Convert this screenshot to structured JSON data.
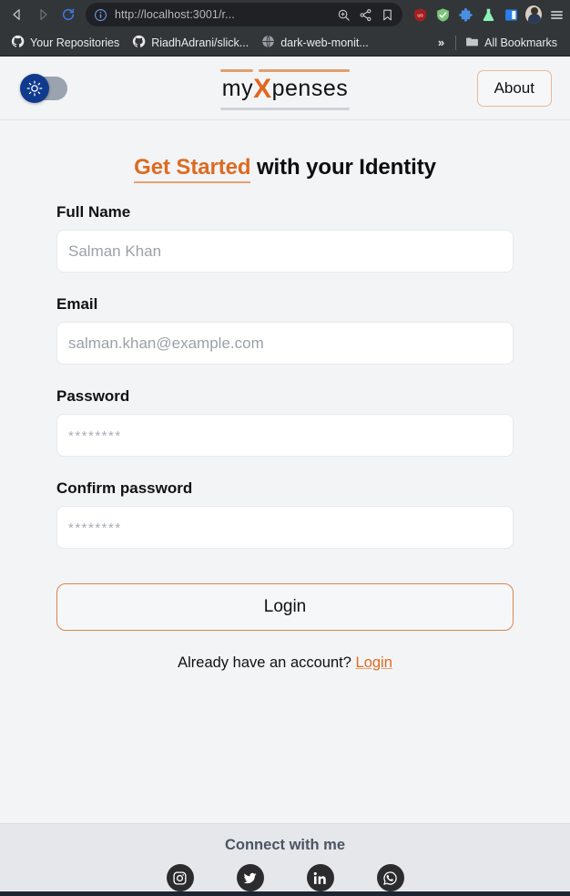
{
  "browser": {
    "nav": {
      "back_icon": "back-arrow-icon",
      "forward_icon": "forward-arrow-icon",
      "reload_icon": "reload-icon"
    },
    "urlbar": {
      "site_info_icon": "site-info-icon",
      "url": "http://localhost:3001/r...",
      "zoom_icon": "zoom-icon",
      "share_icon": "share-icon",
      "bookmark_icon": "bookmark-star-icon"
    },
    "extensions": [
      {
        "name": "ublock-origin-icon",
        "color": "#a81e1e",
        "label": "uo"
      },
      {
        "name": "shield-check-icon",
        "color": "#7bc67b"
      },
      {
        "name": "puzzle-extensions-icon",
        "color": "#4a90e2"
      },
      {
        "name": "flask-beaker-icon",
        "color": "#8ef2b8"
      },
      {
        "name": "sidebar-panel-icon",
        "color": "#2b7de9"
      },
      {
        "name": "profile-avatar-icon"
      },
      {
        "name": "browser-menu-icon"
      }
    ],
    "bookmarks": [
      {
        "label": "Your Repositories",
        "icon": "github-icon"
      },
      {
        "label": "RiadhAdrani/slick...",
        "icon": "github-icon"
      },
      {
        "label": "dark-web-monit...",
        "icon": "globe-icon"
      }
    ],
    "overflow_label": "»",
    "all_bookmarks": {
      "label": "All Bookmarks",
      "icon": "folder-icon"
    }
  },
  "header": {
    "theme_toggle": {
      "name": "theme-toggle",
      "state": "light",
      "icon": "sun-icon"
    },
    "logo": {
      "prefix": "my",
      "accent": "X",
      "suffix": "penses",
      "accent_color": "#e2661f",
      "rule_color": "#e0a070"
    },
    "about_label": "About"
  },
  "main": {
    "headline": {
      "accent": "Get Started",
      "rest": " with your Identity"
    },
    "fields": [
      {
        "label": "Full Name",
        "placeholder": "Salman Khan",
        "value": "",
        "type": "text",
        "name": "full-name"
      },
      {
        "label": "Email",
        "placeholder": "salman.khan@example.com",
        "value": "",
        "type": "email",
        "name": "email"
      },
      {
        "label": "Password",
        "placeholder": "********",
        "value": "",
        "type": "password",
        "name": "password"
      },
      {
        "label": "Confirm password",
        "placeholder": "********",
        "value": "",
        "type": "password",
        "name": "confirm-password"
      }
    ],
    "submit_label": "Login",
    "already_text": "Already have an account?",
    "already_link": "Login"
  },
  "footer": {
    "title": "Connect with me",
    "socials": [
      {
        "name": "instagram-icon"
      },
      {
        "name": "twitter-icon"
      },
      {
        "name": "linkedin-icon"
      },
      {
        "name": "whatsapp-icon"
      }
    ]
  },
  "colors": {
    "accent_orange": "#dd6b20",
    "page_bg": "#f3f4f6",
    "footer_bg": "#e5e7eb",
    "chrome_bg": "#323639",
    "urlbar_bg": "#202124",
    "social_bg": "#2c2c2e"
  }
}
